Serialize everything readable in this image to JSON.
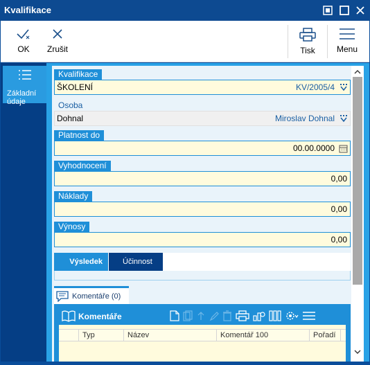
{
  "window": {
    "title": "Kvalifikace"
  },
  "toolbar": {
    "ok_label": "OK",
    "cancel_label": "Zrušit",
    "print_label": "Tisk",
    "menu_label": "Menu"
  },
  "sidebar": {
    "items": [
      {
        "label_line1": "Základní",
        "label_line2": "údaje",
        "icon": "list-icon"
      }
    ]
  },
  "fields": {
    "kvalifikace": {
      "label": "Kvalifikace",
      "value_left": "ŠKOLENÍ",
      "value_right": "KV/2005/4"
    },
    "osoba": {
      "label": "Osoba",
      "value_left": "Dohnal",
      "value_right": "Miroslav Dohnal"
    },
    "platnost": {
      "label": "Platnost do",
      "value": "00.00.0000"
    },
    "vyhodnoceni": {
      "label": "Vyhodnocení",
      "value": "0,00"
    },
    "naklady": {
      "label": "Náklady",
      "value": "0,00"
    },
    "vynosy": {
      "label": "Výnosy",
      "value": "0,00"
    }
  },
  "tabs": [
    {
      "label": "Výsledek"
    },
    {
      "label": "Účinnost"
    }
  ],
  "comments": {
    "tab_label": "Komentáře (0)",
    "panel_title": "Komentáře",
    "columns": [
      "Typ",
      "Název",
      "Komentář 100",
      "Pořadí"
    ]
  },
  "colors": {
    "accent": "#1f8fd8",
    "dark": "#053e85",
    "field_bg": "#fffbdd"
  }
}
